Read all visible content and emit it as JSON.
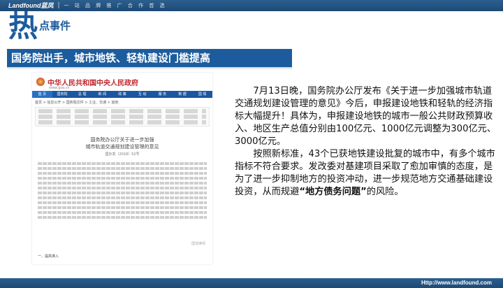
{
  "header": {
    "brand": "Landfound蓝凤",
    "slogan": "一 站 品 牌 推 广 合 作 首 选"
  },
  "title": {
    "hot": "热",
    "sub": "点事件"
  },
  "headline": "国务院出手，城市地铁、轻轨建设门槛提高",
  "doc": {
    "gov_title": "中华人民共和国中央人民政府",
    "gov_url": "www.gov.cn",
    "nav": [
      "首 页",
      "国务院",
      "总 理",
      "新 闻",
      "政 策",
      "互 动",
      "服 务",
      "数 据",
      "国 情"
    ],
    "crumb": "首页 > 信息公开 > 国务院文件 > 工业、交通 > 其他",
    "doc_head_1": "国务院办公厅关于进一步加强",
    "doc_head_2": "城市轨道交通规划建设管理的意见",
    "doc_num": "国办发〔2018〕52号",
    "footer": "一、提高准入",
    "watermark": "国浩律师"
  },
  "article": {
    "p1": "7月13日晚，国务院办公厅发布《关于进一步加强城市轨道交通规划建设管理的意见》今后，申报建设地铁和轻轨的经济指标大幅提升！具体为，申报建设地铁的城市一般公共财政预算收入、地区生产总值分别由100亿元、1000亿元调整为300亿元、3000亿元。",
    "p2_pre": "按照新标准，43个已获地铁建设批复的城市中，有多个城市指标不符合要求。发改委对基建项目采取了愈加审慎的态度，是为了进一步抑制地方的投资冲动，进一步规范地方交通基础建设投资，从而规避",
    "p2_em": "“地方债务问题”",
    "p2_post": "的风险。"
  },
  "footer": {
    "url": "Http://www.landfound.com"
  }
}
